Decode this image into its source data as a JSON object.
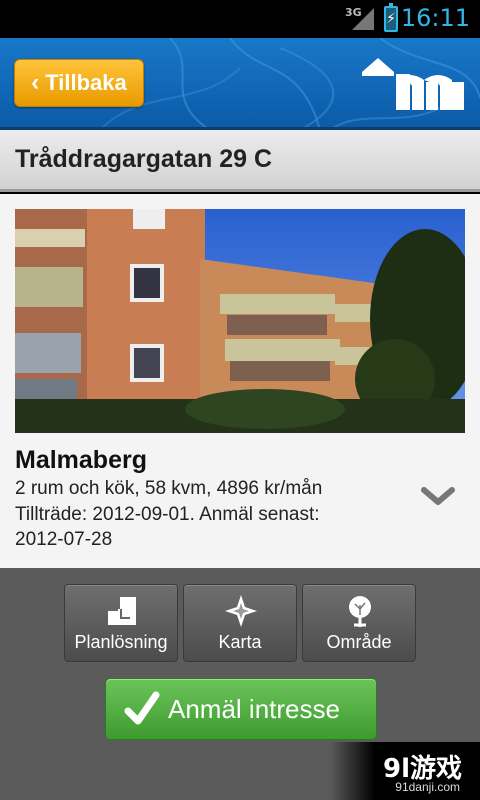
{
  "status_bar": {
    "network": "3G",
    "time": "16:11"
  },
  "header": {
    "back_label": "Tillbaka",
    "logo_icon": "m-house-logo",
    "background_color": "#1470c0",
    "back_color": "#f5a811"
  },
  "listing": {
    "title": "Tråddragargatan 29 C",
    "area": "Malmaberg",
    "details_line1": "2 rum och kök, 58 kvm, 4896 kr/mån",
    "details_line2": "Tillträde: 2012-09-01. Anmäl senast:",
    "details_line3": "2012-07-28",
    "expand_icon": "chevron-down-icon"
  },
  "actions": {
    "tiles": [
      {
        "label": "Planlösning",
        "icon": "floorplan-icon"
      },
      {
        "label": "Karta",
        "icon": "compass-icon"
      },
      {
        "label": "Område",
        "icon": "tree-icon"
      }
    ],
    "cta_label": "Anmäl intresse",
    "cta_color": "#4caf3a"
  },
  "watermark": {
    "main": "9l游戏",
    "sub": "91danji.com"
  }
}
